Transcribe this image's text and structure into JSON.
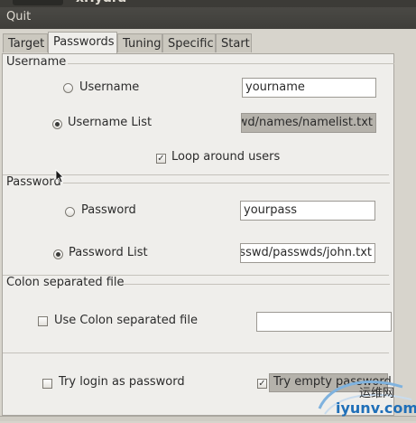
{
  "window": {
    "title": "xHydra"
  },
  "menu": {
    "quit": "Quit"
  },
  "tabs": [
    {
      "label": "Target",
      "active": false
    },
    {
      "label": "Passwords",
      "active": true
    },
    {
      "label": "Tuning",
      "active": false
    },
    {
      "label": "Specific",
      "active": false
    },
    {
      "label": "Start",
      "active": false
    }
  ],
  "username_group": {
    "title": "Username",
    "username_radio": {
      "label": "Username",
      "selected": false
    },
    "username_value": "yourname",
    "list_radio": {
      "label": "Username List",
      "selected": true
    },
    "list_value": "/passwd/names/namelist.txt",
    "loop_checkbox": {
      "label": "Loop around users",
      "checked": true
    }
  },
  "password_group": {
    "title": "Password",
    "password_radio": {
      "label": "Password",
      "selected": false
    },
    "password_value": "yourpass",
    "list_radio": {
      "label": "Password List",
      "selected": true
    },
    "list_value": "passwd/passwds/john.txt"
  },
  "colon_group": {
    "title": "Colon separated file",
    "checkbox": {
      "label": "Use Colon separated file",
      "checked": false
    },
    "value": ""
  },
  "bottom": {
    "try_login": {
      "label": "Try login as password",
      "checked": false
    },
    "try_empty": {
      "label": "Try empty password",
      "checked": true
    }
  },
  "watermark": {
    "text": "运维网",
    "url": "iyunv.com"
  },
  "colors": {
    "accent": "#1f6fb8",
    "menubar": "#3f3e3a"
  }
}
